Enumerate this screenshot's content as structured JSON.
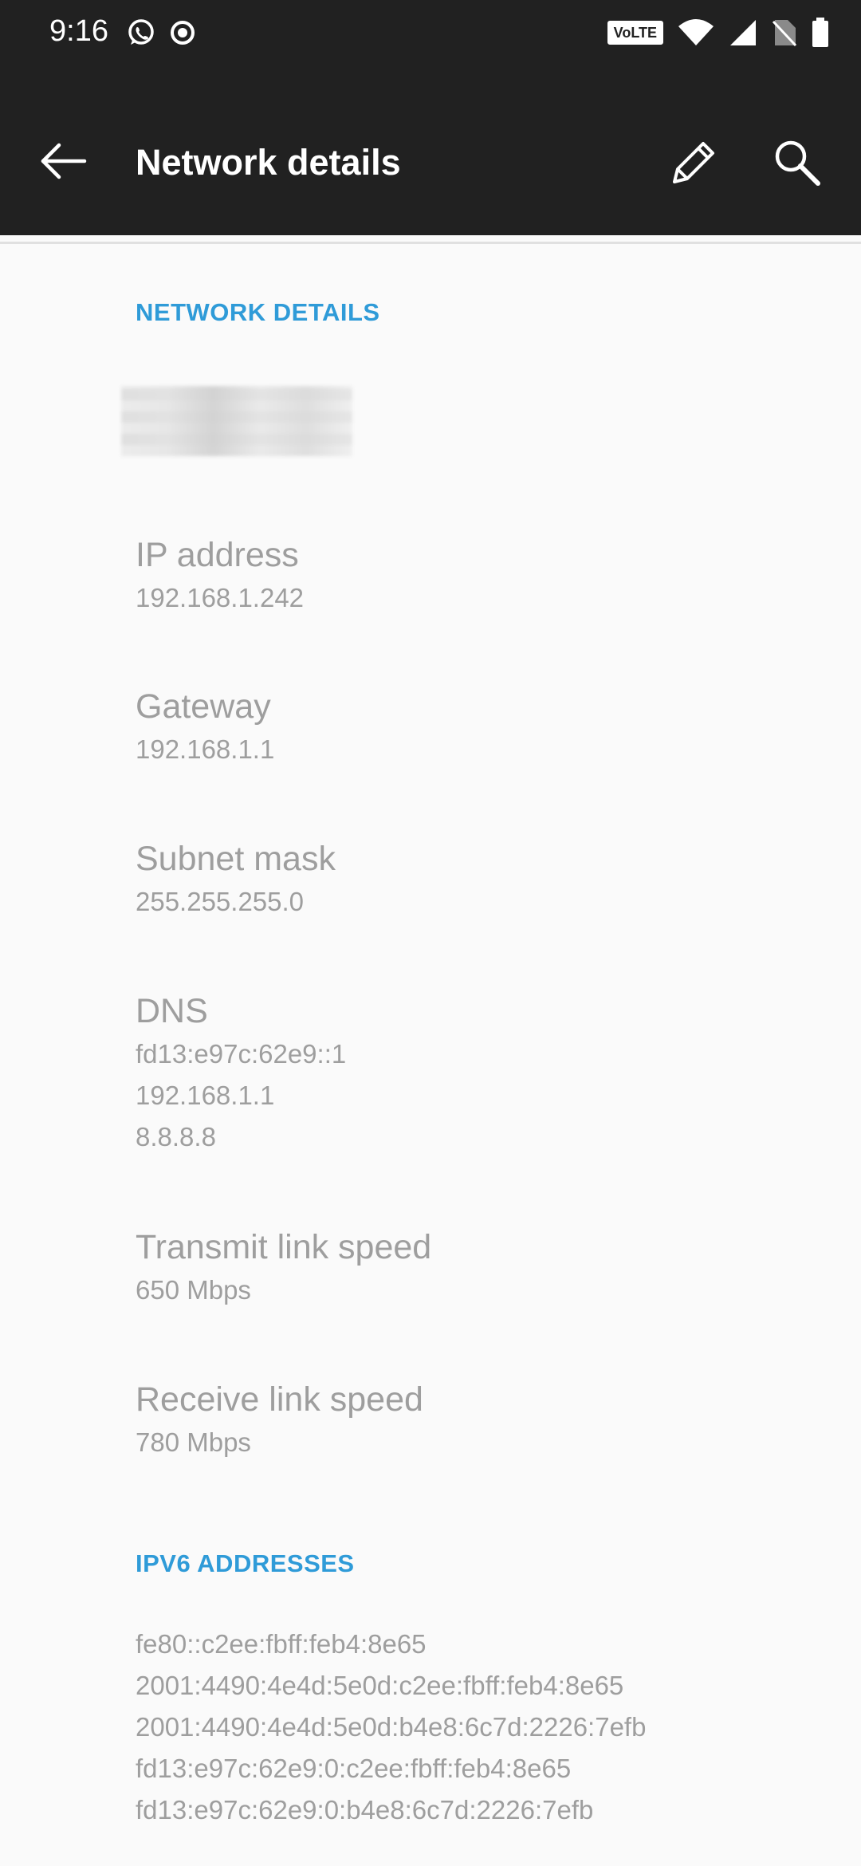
{
  "status_bar": {
    "time": "9:16",
    "left_icons": [
      "whatsapp-icon",
      "location-ring-icon"
    ],
    "volte_label": "VoLTE",
    "right_icons": [
      "wifi-icon",
      "cell-signal-icon",
      "no-sim-icon",
      "battery-icon"
    ]
  },
  "toolbar": {
    "title": "Network details",
    "back_icon": "back-arrow-icon",
    "edit_icon": "pencil-icon",
    "search_icon": "search-icon"
  },
  "sections": {
    "network_details_header": "NETWORK DETAILS",
    "ipv6_header": "IPV6 ADDRESSES"
  },
  "items": {
    "ip_address": {
      "title": "IP address",
      "value": "192.168.1.242"
    },
    "gateway": {
      "title": "Gateway",
      "value": "192.168.1.1"
    },
    "subnet_mask": {
      "title": "Subnet mask",
      "value": "255.255.255.0"
    },
    "dns": {
      "title": "DNS",
      "values": [
        "fd13:e97c:62e9::1",
        "192.168.1.1",
        "8.8.8.8"
      ]
    },
    "transmit_speed": {
      "title": "Transmit link speed",
      "value": "650 Mbps"
    },
    "receive_speed": {
      "title": "Receive link speed",
      "value": "780 Mbps"
    }
  },
  "ipv6_addresses": [
    "fe80::c2ee:fbff:feb4:8e65",
    "2001:4490:4e4d:5e0d:c2ee:fbff:feb4:8e65",
    "2001:4490:4e4d:5e0d:b4e8:6c7d:2226:7efb",
    "fd13:e97c:62e9:0:c2ee:fbff:feb4:8e65",
    "fd13:e97c:62e9:0:b4e8:6c7d:2226:7efb"
  ],
  "colors": {
    "toolbar_bg": "#212121",
    "accent": "#2f9bd8",
    "text_secondary": "#9e9e9e",
    "background": "#fafafa"
  }
}
